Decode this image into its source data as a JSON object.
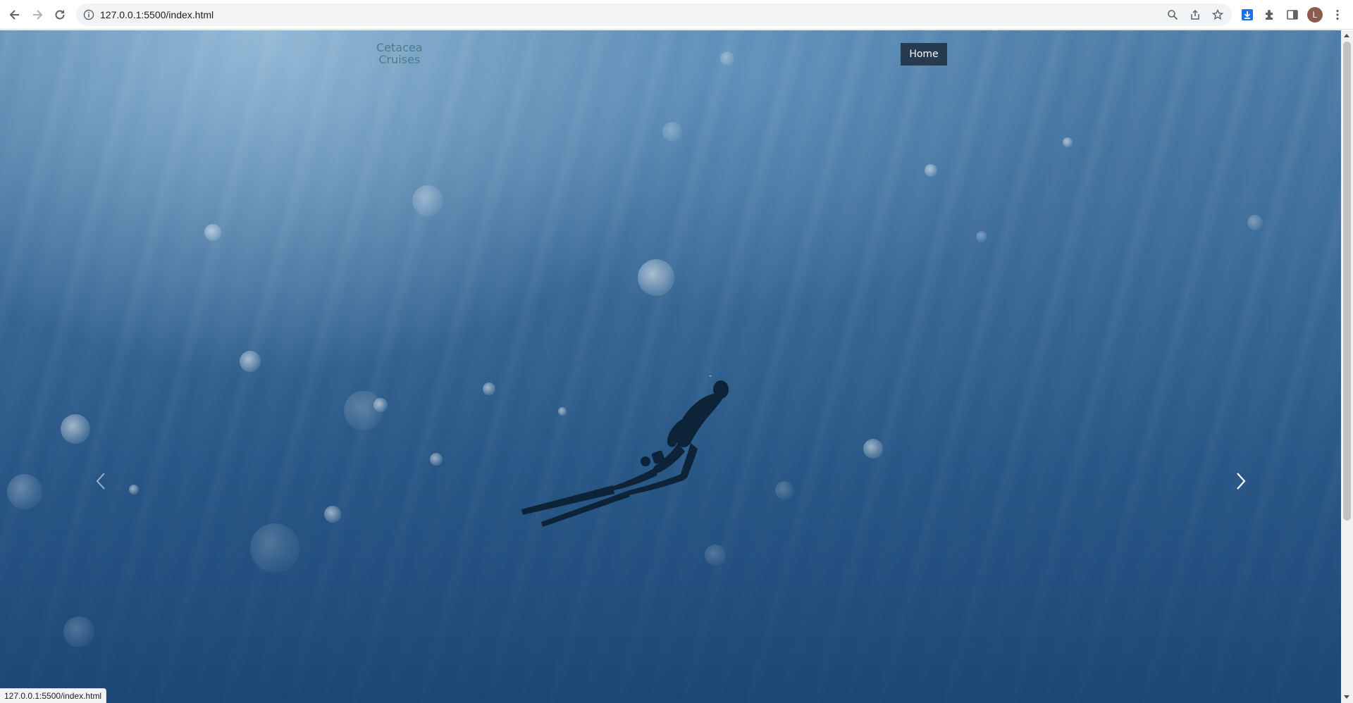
{
  "browser": {
    "url": "127.0.0.1:5500/index.html",
    "status_url": "127.0.0.1:5500/index.html",
    "profile_initial": "L",
    "icons": {
      "back": "back-arrow-icon",
      "forward": "forward-arrow-icon",
      "reload": "reload-icon",
      "info": "info-icon",
      "zoom": "zoom-icon",
      "share": "share-icon",
      "bookmark": "star-icon",
      "download": "download-icon",
      "extensions": "puzzle-icon",
      "side_panel": "side-panel-icon",
      "menu": "kebab-menu-icon"
    }
  },
  "site": {
    "brand_line1": "Cetacea",
    "brand_line2": "Cruises",
    "nav": {
      "active_label": "Home",
      "active_bg": "#263a50"
    },
    "hero": {
      "prev_icon": "chevron-left-icon",
      "next_icon": "chevron-right-icon"
    }
  },
  "colors": {
    "brand": "#4a7f86",
    "ocean_top": "#4f7fa9",
    "ocean_bottom": "#1c4676"
  }
}
